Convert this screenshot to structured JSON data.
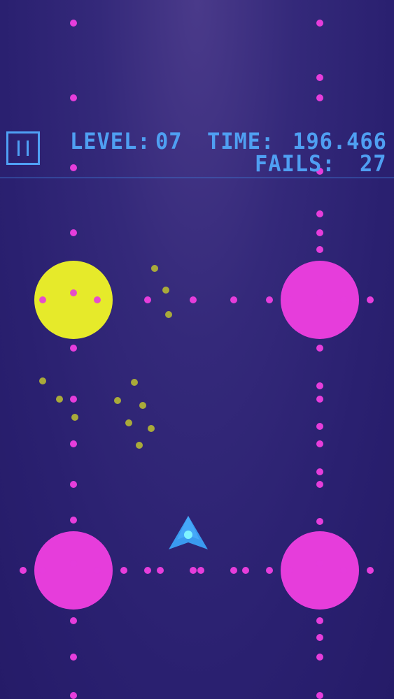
{
  "hud": {
    "level_label": "LEVEL:",
    "level_value": "07",
    "time_label": "TIME:",
    "time_value": "196.466",
    "fails_label": "FAILS:",
    "fails_value": "27"
  },
  "buttons": {
    "pause_icon": "pause-icon"
  },
  "colors": {
    "hud": "#4f9ff2",
    "orb_active": "#e6ea2a",
    "orb_inactive": "#e63ddb",
    "track_dot": "#e63ddb",
    "debris": "#a9aa3a",
    "ship": "#3a9af0",
    "ship_core": "#7ff3ff"
  },
  "orbs": [
    {
      "id": "top-left",
      "state": "active"
    },
    {
      "id": "top-right",
      "state": "inactive"
    },
    {
      "id": "bottom-left",
      "state": "inactive"
    },
    {
      "id": "bottom-right",
      "state": "inactive"
    }
  ]
}
